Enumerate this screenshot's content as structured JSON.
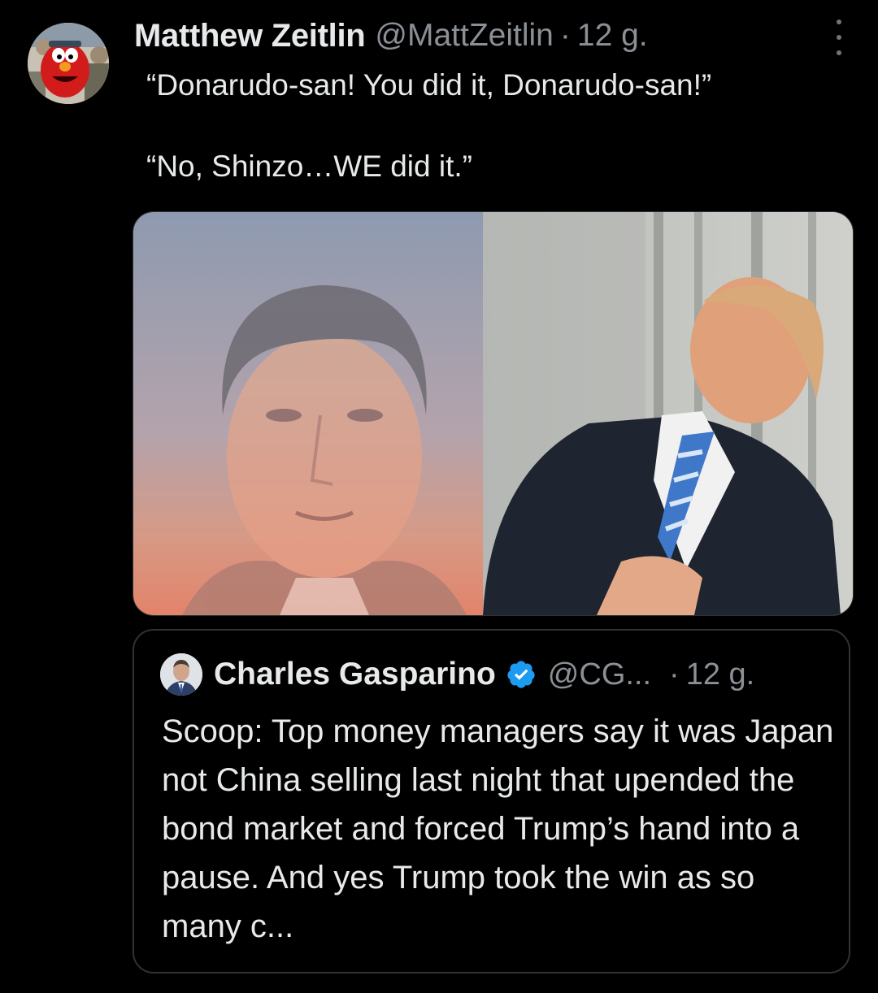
{
  "tweet": {
    "author_name": "Matthew Zeitlin",
    "author_handle": "@MattZeitlin",
    "separator": "·",
    "time": "12 g.",
    "text": "“Donarudo-san! You did it, Donarudo-san!”\n\n“No, Shinzo…WE did it.”"
  },
  "quote": {
    "author_name": "Charles Gasparino",
    "author_handle": "@CG...",
    "separator": "·",
    "time": "12 g.",
    "text": "Scoop: Top money managers say it was Japan not China selling last night that upended the bond market and forced Trump’s hand into a pause. And yes Trump took the win as so many c..."
  },
  "icons": {
    "more": "more-vertical-icon",
    "verified": "verified-badge-icon"
  },
  "colors": {
    "background": "#000000",
    "text": "#e7e9ea",
    "muted": "#8b9096",
    "border": "#2f3336",
    "verified": "#1d9bf0"
  }
}
